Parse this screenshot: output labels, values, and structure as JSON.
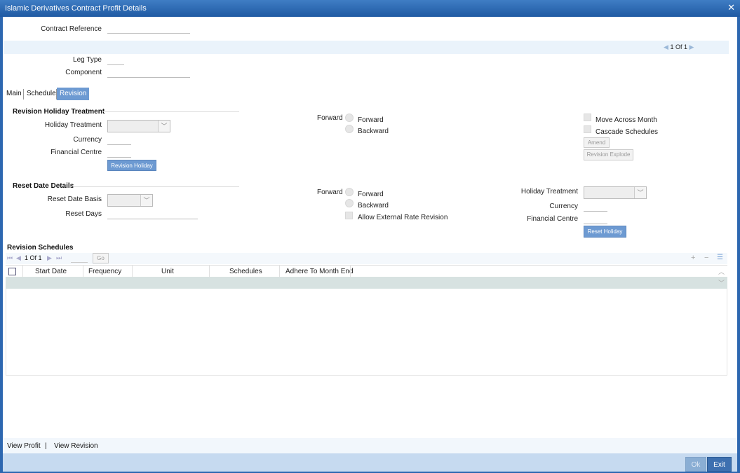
{
  "window": {
    "title": "Islamic Derivatives Contract Profit Details",
    "close_icon": "close-icon"
  },
  "header": {
    "contract_reference_label": "Contract Reference",
    "contract_reference_value": "",
    "pager": {
      "current": "1",
      "of_label": "Of",
      "total": "1"
    },
    "leg_type_label": "Leg Type",
    "leg_type_value": "",
    "component_label": "Component",
    "component_value": ""
  },
  "tabs": [
    {
      "label": "Main",
      "active": false
    },
    {
      "label": "Schedule",
      "active": false
    },
    {
      "label": "Revision",
      "active": true
    }
  ],
  "revision_holiday": {
    "section_title": "Revision Holiday Treatment",
    "holiday_treatment_label": "Holiday Treatment",
    "holiday_treatment_value": "",
    "currency_label": "Currency",
    "currency_value": "",
    "financial_centre_label": "Financial Centre",
    "financial_centre_value": "",
    "button_label": "Revision Holiday",
    "forward_group_label": "Forward",
    "forward_option": "Forward",
    "backward_option": "Backward",
    "move_across_month_label": "Move Across Month",
    "cascade_schedules_label": "Cascade Schedules",
    "amend_button": "Amend",
    "revision_explode_button": "Revision Explode"
  },
  "reset_date": {
    "section_title": "Reset Date Details",
    "reset_date_basis_label": "Reset Date Basis",
    "reset_date_basis_value": "",
    "reset_days_label": "Reset Days",
    "reset_days_value": "",
    "forward_group_label": "Forward",
    "forward_option": "Forward",
    "backward_option": "Backward",
    "allow_external_label": "Allow External Rate Revision",
    "holiday_treatment_label": "Holiday Treatment",
    "holiday_treatment_value": "",
    "currency_label": "Currency",
    "currency_value": "",
    "financial_centre_label": "Financial Centre",
    "financial_centre_value": "",
    "reset_holiday_button": "Reset Holiday"
  },
  "schedules": {
    "section_title": "Revision Schedules",
    "pager_text": "1 Of 1",
    "go_button": "Go",
    "columns": [
      "Start Date",
      "Frequency",
      "Unit",
      "Schedules",
      "Adhere To Month End"
    ],
    "rows": []
  },
  "footer": {
    "link_view_profit": "View Profit",
    "separator": "|",
    "link_view_revision": "View Revision",
    "ok_button": "Ok",
    "exit_button": "Exit"
  },
  "colors": {
    "titlebar": "#2f6db5",
    "active_tab": "#6d9ad2",
    "selected_row": "#d7e2e1",
    "footer_bar": "#c6daf0"
  }
}
